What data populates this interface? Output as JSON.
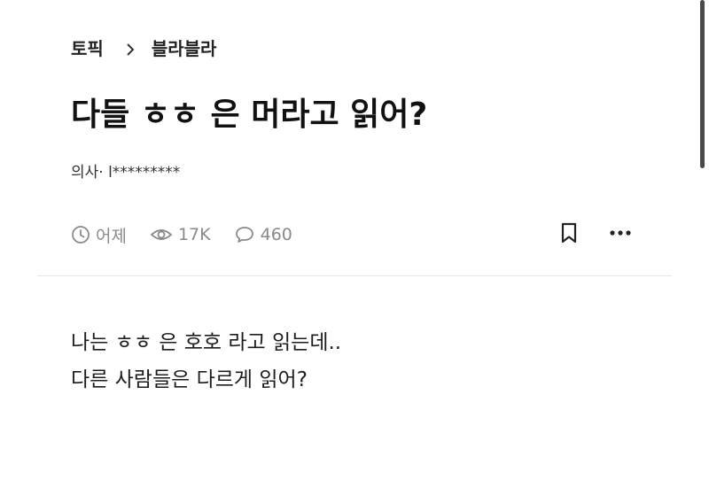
{
  "breadcrumb": {
    "parent": "토픽",
    "current": "블라블라"
  },
  "post": {
    "title": "다들 ㅎㅎ 은 머라고 읽어?",
    "author": "의사· l*********",
    "time": "어제",
    "views": "17K",
    "comments": "460",
    "body": [
      "나는 ㅎㅎ 은 호호 라고 읽는데..",
      "다른 사람들은 다르게 읽어?"
    ]
  },
  "icons": {
    "breadcrumb_separator": "chevron-right-icon",
    "time": "clock-icon",
    "views": "eye-icon",
    "comments": "comment-icon",
    "bookmark": "bookmark-icon",
    "more": "more-icon"
  },
  "colors": {
    "text": "#1a1a1a",
    "meta": "#8a8a8a",
    "divider": "#e6e6e6",
    "background": "#ffffff"
  }
}
